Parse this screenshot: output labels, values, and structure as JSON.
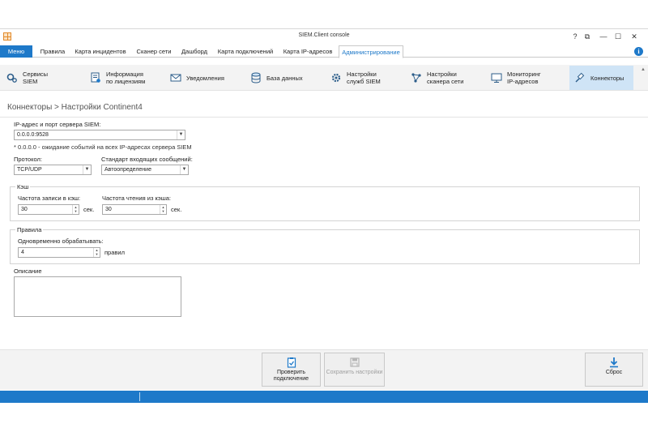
{
  "window": {
    "title": "SIEM.Client console"
  },
  "titlebar": {
    "help": "?",
    "restore": "⧉",
    "minimize": "—",
    "maximize": "☐",
    "close": "✕"
  },
  "menu": {
    "button": "Меню",
    "tabs": [
      "Правила",
      "Карта инцидентов",
      "Сканер сети",
      "Дашборд",
      "Карта подключений",
      "Карта IP-адресов",
      "Администрирование"
    ],
    "active_tab": "Администрирование"
  },
  "ribbon": {
    "items": [
      {
        "label": "Сервисы\nSIEM",
        "icon": "gears-icon"
      },
      {
        "label": "Информация\nпо лицензиям",
        "icon": "license-icon"
      },
      {
        "label": "Уведомления",
        "icon": "notification-icon"
      },
      {
        "label": "База данных",
        "icon": "database-icon"
      },
      {
        "label": "Настройки\nслужб SIEM",
        "icon": "settings-gear-icon"
      },
      {
        "label": "Настройки\nсканера сети",
        "icon": "network-icon"
      },
      {
        "label": "Мониторинг\nIP-адресов",
        "icon": "monitor-icon"
      },
      {
        "label": "Коннекторы",
        "icon": "connector-icon"
      }
    ],
    "active": "Коннекторы"
  },
  "breadcrumb": "Коннекторы > Настройки Continent4",
  "form": {
    "ip_label": "IP-адрес и порт сервера SIEM:",
    "ip_value": "0.0.0.0:9528",
    "ip_hint": "* 0.0.0.0 - ожидание событий на всех IP-адресах сервера SIEM",
    "protocol_label": "Протокол:",
    "protocol_value": "TCP/UDP",
    "standard_label": "Стандарт входящих сообщений:",
    "standard_value": "Автоопределение",
    "cache_group": "Кэш",
    "cache_write_label": "Частота записи в кэш:",
    "cache_write_value": "30",
    "cache_write_unit": "сек.",
    "cache_read_label": "Частота чтения из кэша:",
    "cache_read_value": "30",
    "cache_read_unit": "сек.",
    "rules_group": "Правила",
    "rules_label": "Одновременно обрабатывать:",
    "rules_value": "4",
    "rules_unit": "правил",
    "description_label": "Описание"
  },
  "buttons": {
    "check": "Проверить\nподключение",
    "save": "Сохранить настройки",
    "reset": "Сброс"
  },
  "colors": {
    "accent": "#1e79c9",
    "ribbon_active": "#cfe4f6"
  }
}
